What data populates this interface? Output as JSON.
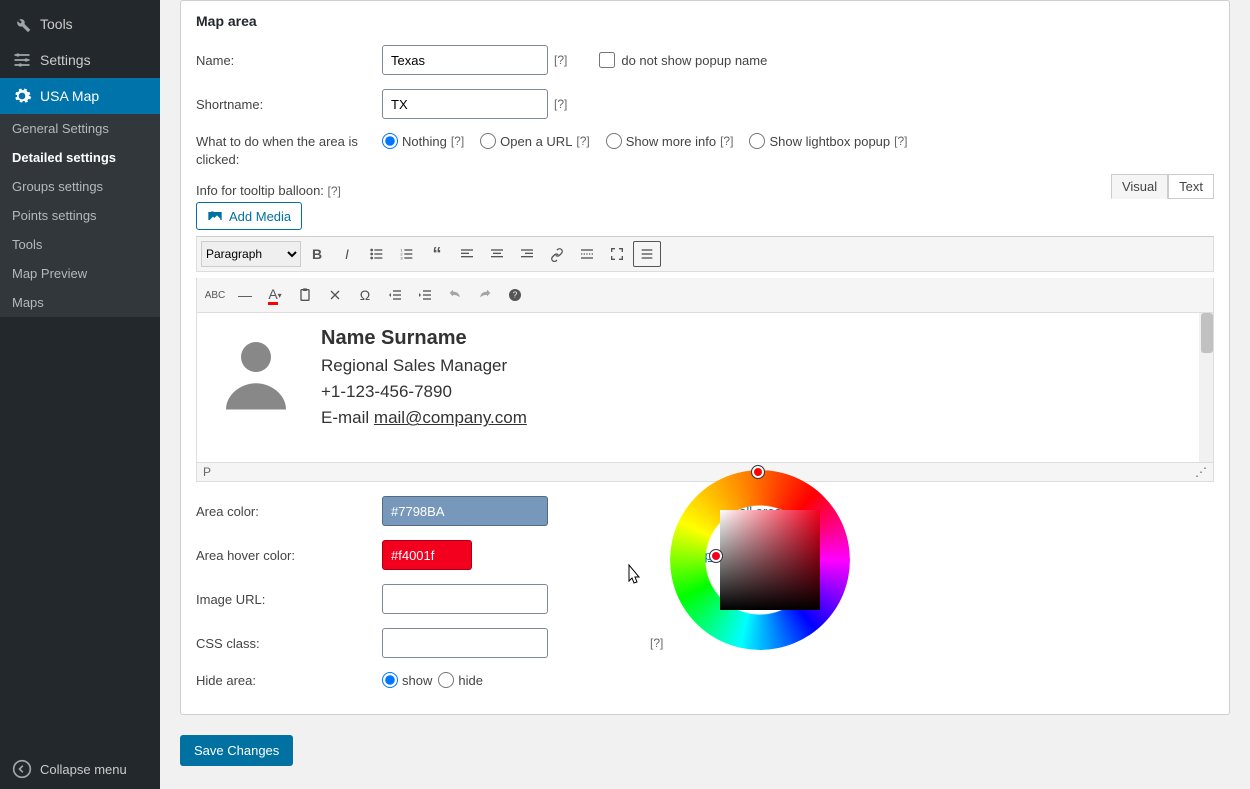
{
  "sidebar": {
    "tools": "Tools",
    "settings": "Settings",
    "usa_map": "USA Map",
    "sub": [
      "General Settings",
      "Detailed settings",
      "Groups settings",
      "Points settings",
      "Tools",
      "Map Preview",
      "Maps"
    ],
    "collapse": "Collapse menu"
  },
  "map_area": {
    "heading": "Map area",
    "name_label": "Name:",
    "name_value": "Texas",
    "shortname_label": "Shortname:",
    "shortname_value": "TX",
    "no_popup_label": "do not show popup name",
    "click_label": "What to do when the area is clicked:",
    "radios": {
      "nothing": "Nothing",
      "url": "Open a URL",
      "info": "Show more info",
      "lightbox": "Show lightbox popup"
    },
    "tooltip_label": "Info for tooltip balloon:",
    "add_media": "Add Media",
    "tabs": {
      "visual": "Visual",
      "text": "Text"
    },
    "paragraph": "Paragraph",
    "contact": {
      "name": "Name Surname",
      "role": "Regional Sales Manager",
      "phone": "+1-123-456-7890",
      "email_prefix": "E-mail ",
      "email": "mail@company.com"
    },
    "status_path": "P",
    "area_color_label": "Area color:",
    "area_color_value": "#7798BA",
    "hover_color_label": "Area hover color:",
    "hover_color_value": "#f4001f",
    "image_url_label": "Image URL:",
    "css_class_label": "CSS class:",
    "hide_area_label": "Hide area:",
    "show": "show",
    "hide": "hide",
    "apply_all": "apply to all areas",
    "help": "[?]"
  },
  "save": "Save Changes"
}
